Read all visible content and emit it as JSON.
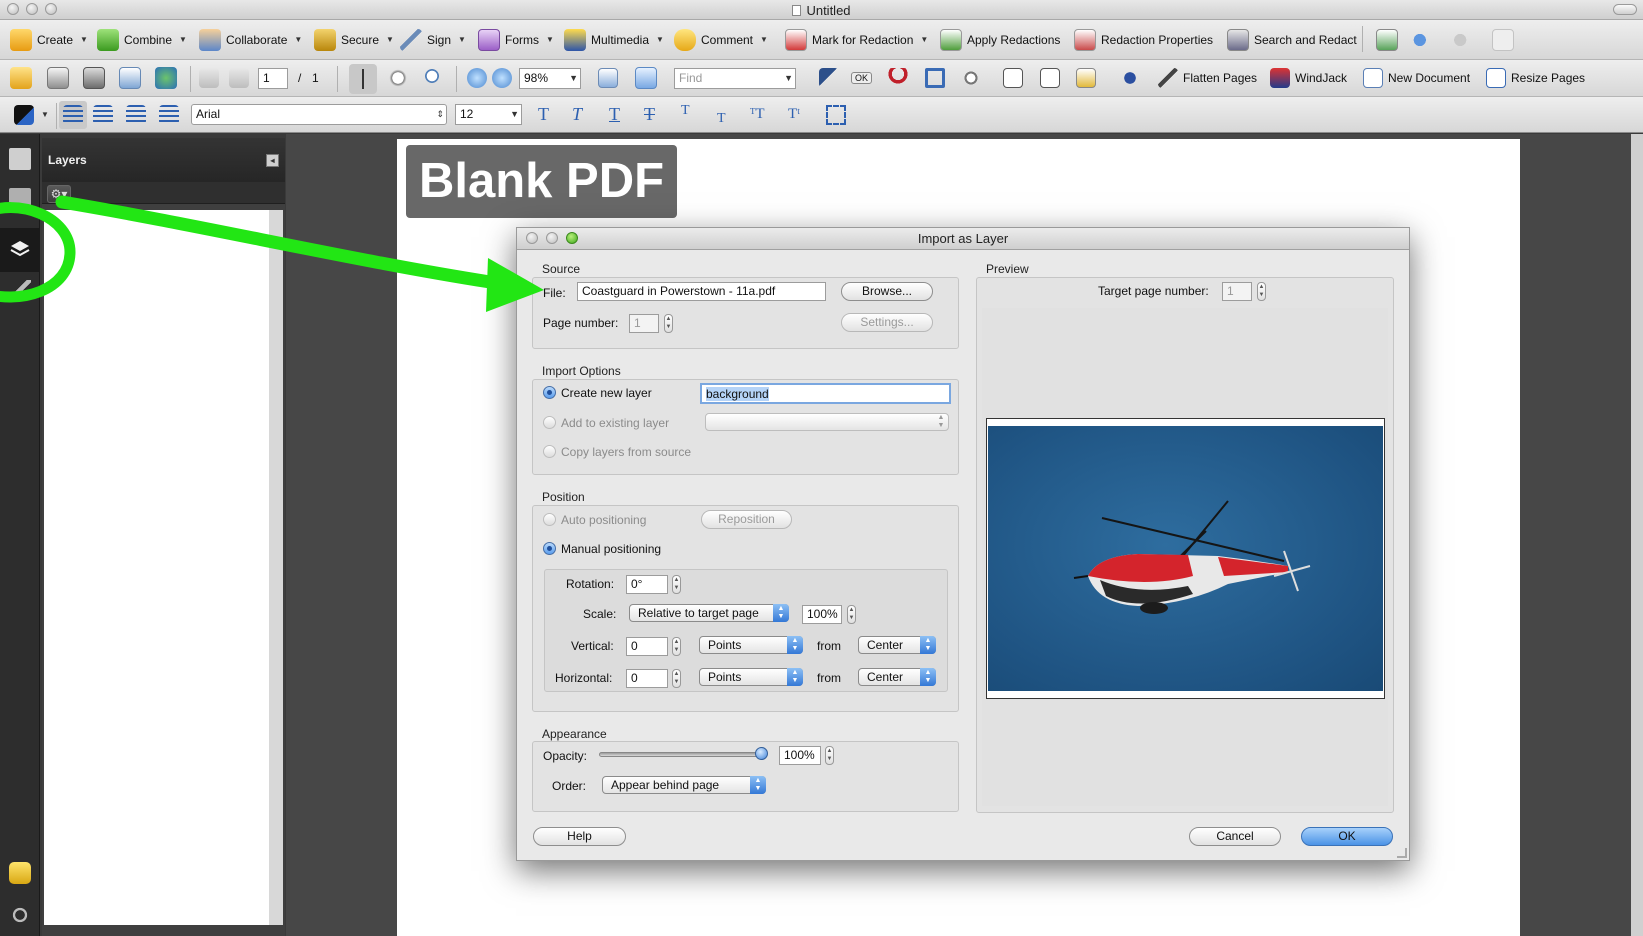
{
  "window": {
    "title": "Untitled"
  },
  "toolbar1": {
    "create": "Create",
    "combine": "Combine",
    "collaborate": "Collaborate",
    "secure": "Secure",
    "sign": "Sign",
    "forms": "Forms",
    "multimedia": "Multimedia",
    "comment": "Comment",
    "mark_redaction": "Mark for Redaction",
    "apply_redactions": "Apply Redactions",
    "redaction_properties": "Redaction Properties",
    "search_redact": "Search and Redact"
  },
  "toolbar2": {
    "current_page": "1",
    "page_sep": "/",
    "page_total": "1",
    "zoom": "98%",
    "find_placeholder": "Find",
    "ok_label": "OK",
    "flatten_pages": "Flatten Pages",
    "windjack": "WindJack",
    "new_document": "New Document",
    "resize_pages": "Resize Pages"
  },
  "toolbar3": {
    "font_family": "Arial",
    "font_size": "12"
  },
  "layers_panel": {
    "title": "Layers"
  },
  "document": {
    "badge_text": "Blank PDF"
  },
  "dialog": {
    "title": "Import as Layer",
    "source": {
      "label": "Source",
      "file_label": "File:",
      "file_value": "Coastguard in Powerstown - 11a.pdf",
      "browse": "Browse...",
      "page_number_label": "Page number:",
      "page_number_value": "1",
      "settings": "Settings..."
    },
    "import_options": {
      "label": "Import Options",
      "create_new_layer": "Create new layer",
      "new_layer_name": "background",
      "add_to_existing": "Add to existing layer",
      "copy_layers": "Copy layers from source"
    },
    "position": {
      "label": "Position",
      "auto": "Auto positioning",
      "reposition": "Reposition",
      "manual": "Manual positioning",
      "rotation_label": "Rotation:",
      "rotation_value": "0°",
      "scale_label": "Scale:",
      "scale_mode": "Relative to target page",
      "scale_value": "100%",
      "vertical_label": "Vertical:",
      "vertical_value": "0",
      "vertical_unit": "Points",
      "horizontal_label": "Horizontal:",
      "horizontal_value": "0",
      "horizontal_unit": "Points",
      "from_label": "from",
      "vertical_from": "Center",
      "horizontal_from": "Center"
    },
    "appearance": {
      "label": "Appearance",
      "opacity_label": "Opacity:",
      "opacity_value": "100%",
      "order_label": "Order:",
      "order_value": "Appear behind page"
    },
    "preview": {
      "label": "Preview",
      "target_page_label": "Target page number:",
      "target_page_value": "1"
    },
    "buttons": {
      "help": "Help",
      "cancel": "Cancel",
      "ok": "OK"
    }
  },
  "colors": {
    "annotation_green": "#22e614",
    "accent_blue": "#3478d6",
    "sky_blue": "#1f5483"
  }
}
